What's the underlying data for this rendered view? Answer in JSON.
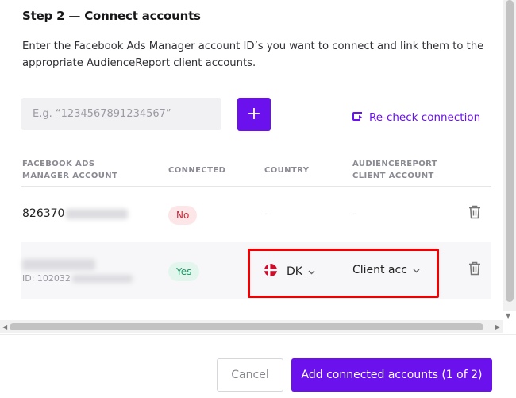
{
  "step": {
    "title": "Step 2 — Connect accounts",
    "description": "Enter the Facebook Ads Manager account ID’s you want to connect and link them to the appropriate AudienceReport client accounts."
  },
  "input": {
    "placeholder": "E.g. “1234567891234567”",
    "add_label": "+"
  },
  "recheck_label": "Re-check connection",
  "table": {
    "headers": {
      "account": "FACEBOOK ADS MANAGER ACCOUNT",
      "connected": "CONNECTED",
      "country": "COUNTRY",
      "client": "AUDIENCEREPORT CLIENT ACCOUNT"
    },
    "rows": [
      {
        "account_prefix": "826370",
        "connected": "No",
        "country": "-",
        "client": "-"
      },
      {
        "account_sub_prefix": "ID: 102032",
        "connected": "Yes",
        "country": "DK",
        "client": "Client acc"
      }
    ]
  },
  "footer": {
    "cancel": "Cancel",
    "primary": "Add connected accounts (1 of 2)"
  },
  "colors": {
    "accent": "#6a11ee",
    "no_badge": "#fde6e8",
    "yes_badge": "#e3f6ee",
    "highlight": "#f00000"
  }
}
